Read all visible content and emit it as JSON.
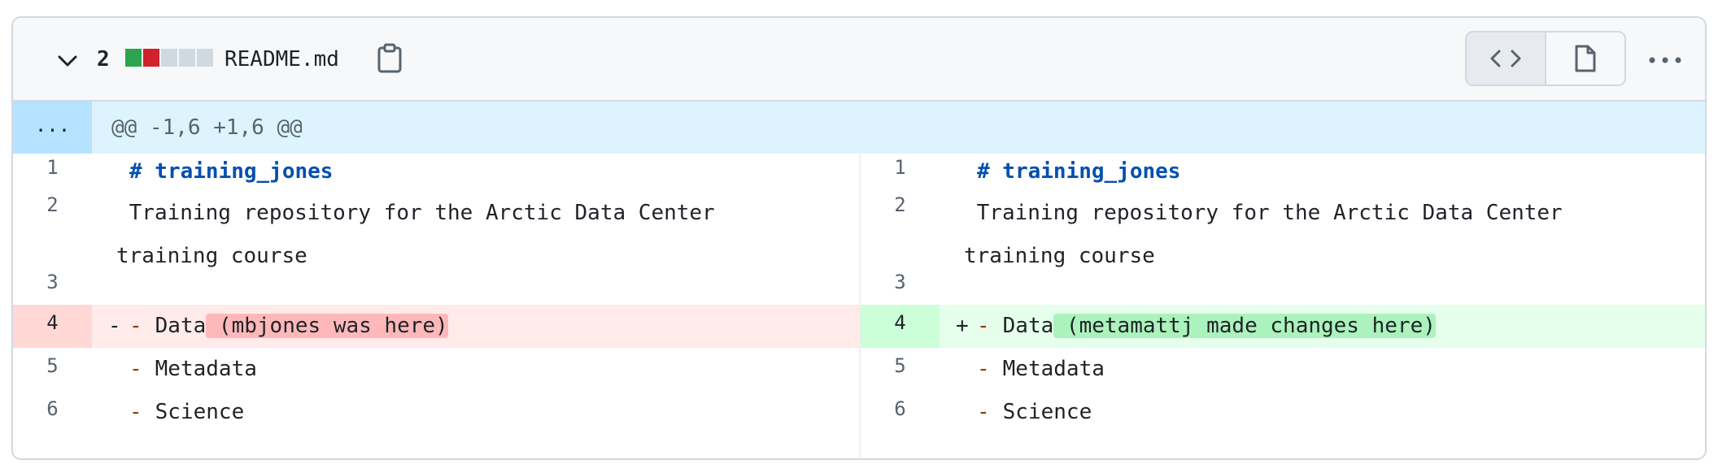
{
  "file_header": {
    "changes_count": "2",
    "diffstat_colors": [
      "#2da44e",
      "#cf222e",
      "#d1d9e0",
      "#d1d9e0",
      "#d1d9e0"
    ],
    "file_name": "README.md",
    "icons": [
      "chevron-down-icon",
      "copy-clipboard-icon",
      "code-view-icon",
      "file-view-icon",
      "kebab-horizontal-icon"
    ]
  },
  "hunk": {
    "expand_label": "...",
    "header": "@@ -1,6 +1,6 @@"
  },
  "left": {
    "rows": [
      {
        "num": "1",
        "prefix": " ",
        "heading": "# training_jones"
      },
      {
        "num": "2",
        "text1": " Training repository for the Arctic Data Center",
        "text2": "training course"
      },
      {
        "num": "3"
      },
      {
        "num": "4",
        "prefix": "-",
        "bullet": "-",
        "text": " Data",
        "highlight": " (mbjones was here)"
      },
      {
        "num": "5",
        "bullet": "-",
        "text": " Metadata"
      },
      {
        "num": "6",
        "bullet": "-",
        "text": " Science"
      }
    ]
  },
  "right": {
    "rows": [
      {
        "num": "1",
        "heading": "# training_jones"
      },
      {
        "num": "2",
        "text1": " Training repository for the Arctic Data Center",
        "text2": "training course"
      },
      {
        "num": "3"
      },
      {
        "num": "4",
        "prefix": "+",
        "bullet": "-",
        "text": " Data",
        "highlight": " (metamattj made changes here)"
      },
      {
        "num": "5",
        "bullet": "-",
        "text": " Metadata"
      },
      {
        "num": "6",
        "bullet": "-",
        "text": " Science"
      }
    ]
  }
}
